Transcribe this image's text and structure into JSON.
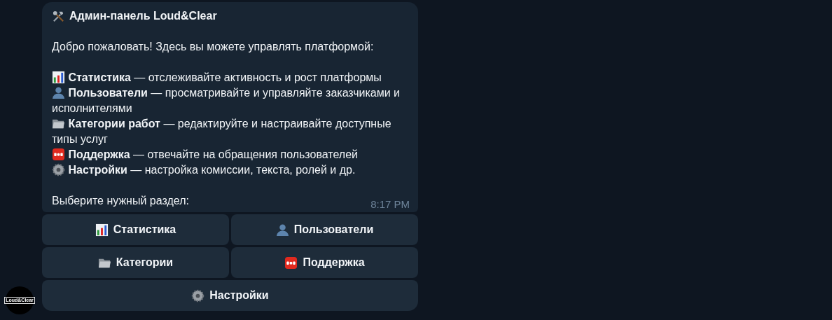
{
  "message": {
    "title": "Админ-панель Loud&Clear",
    "intro": "Добро пожаловать! Здесь вы можете управлять платформой:",
    "items": [
      {
        "kind": "chart",
        "text": "**Статистика** — отслеживайте активность и рост платформы"
      },
      {
        "kind": "user",
        "text": "**Пользователи** — просматривайте и управляйте заказчиками и исполнителями"
      },
      {
        "kind": "folder",
        "text": "**Категории работ** — редактируйте и настраивайте доступные типы услуг"
      },
      {
        "kind": "sos",
        "text": "**Поддержка** — отвечайте на обращения пользователей"
      },
      {
        "kind": "gear",
        "text": "**Настройки** — настройка комиссии, текста, ролей и др."
      }
    ],
    "prompt": "Выберите нужный раздел:",
    "time": "8:17 PM"
  },
  "keyboard": [
    [
      {
        "kind": "chart",
        "label": "Статистика"
      },
      {
        "kind": "user",
        "label": "Пользователи"
      }
    ],
    [
      {
        "kind": "folder",
        "label": "Категории"
      },
      {
        "kind": "sos",
        "label": "Поддержка"
      }
    ],
    [
      {
        "kind": "gear",
        "label": "Настройки"
      }
    ]
  ],
  "avatar": {
    "label": "Loud&Clear"
  }
}
